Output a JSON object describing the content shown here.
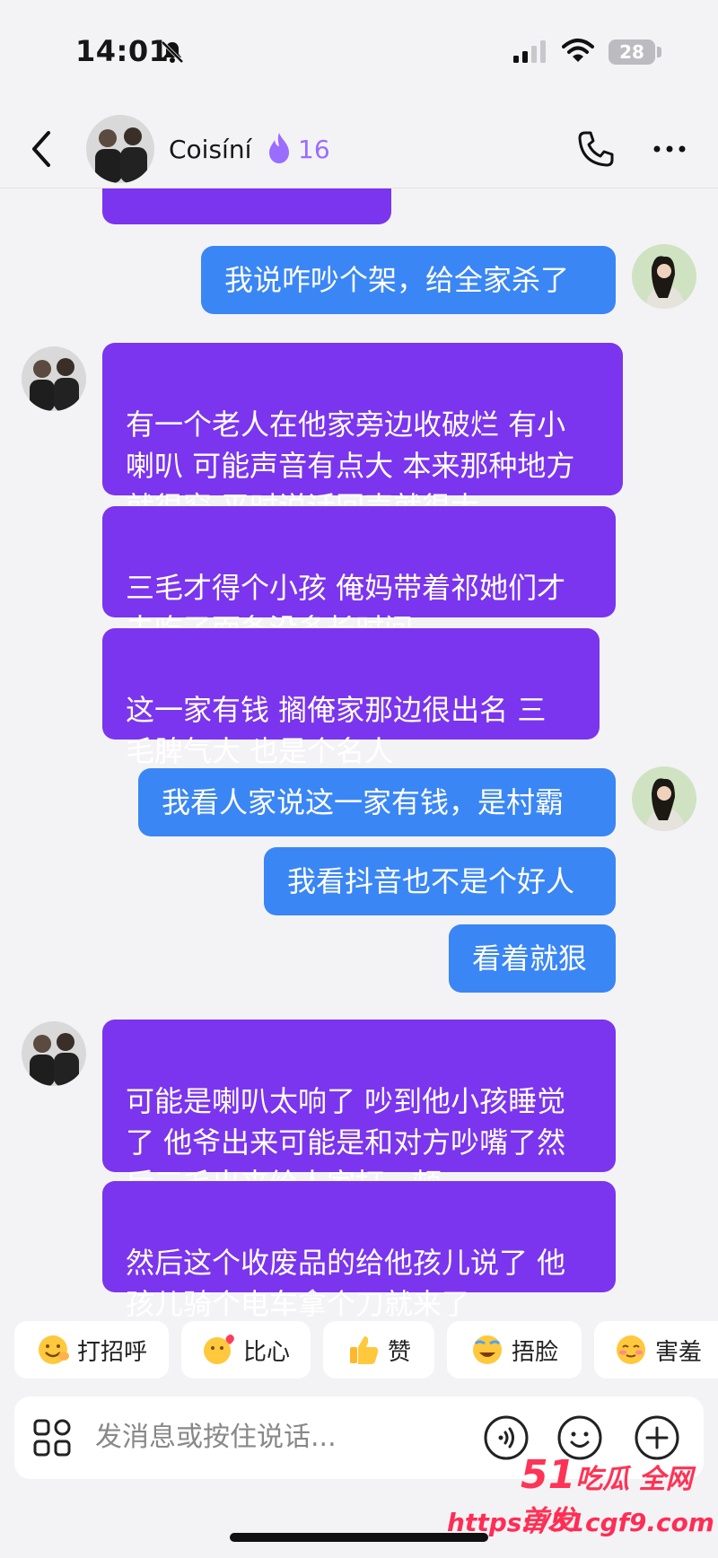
{
  "status_bar": {
    "time": "14:01",
    "battery": "28"
  },
  "header": {
    "contact_name": "Coisíní",
    "flame_count": "16"
  },
  "messages": [
    {
      "side": "left",
      "text": "有一个老人在他家旁边收破烂 有小\n喇叭 可能声音有点大 本来那种地方\n就很窄 平时说话回声就很大"
    },
    {
      "side": "left",
      "text": "三毛才得个小孩 俺妈带着祁她们才\n去吃了面条没多长时间"
    },
    {
      "side": "left",
      "text": "这一家有钱 搁俺家那边很出名  三\n毛脾气大 也是个名人"
    },
    {
      "side": "right",
      "text": "我看人家说这一家有钱，是村霸"
    },
    {
      "side": "right",
      "text": "我看抖音也不是个好人"
    },
    {
      "side": "right",
      "text": "看着就狠"
    },
    {
      "side": "left",
      "text": "可能是喇叭太响了 吵到他小孩睡觉\n了 他爷出来可能是和对方吵嘴了然\n后三毛出来给人家打一顿"
    },
    {
      "side": "left",
      "text": "然后这个收废品的给他孩儿说了 他\n孩儿骑个电车拿个刀就来了"
    }
  ],
  "top_message": {
    "text": "我说咋吵个架，给全家杀了"
  },
  "quick_replies": [
    {
      "label": "打招呼",
      "icon": "wave-emoji-icon"
    },
    {
      "label": "比心",
      "icon": "heart-hand-emoji-icon"
    },
    {
      "label": "赞",
      "icon": "thumbs-up-emoji-icon"
    },
    {
      "label": "捂脸",
      "icon": "facepalm-emoji-icon"
    },
    {
      "label": "害羞",
      "icon": "shy-emoji-icon"
    }
  ],
  "input": {
    "placeholder": "发消息或按住说话..."
  },
  "watermark": {
    "line1_num": "51",
    "line1_text": "吃瓜 全网首发",
    "line2": "https://51cgf9.com"
  },
  "colors": {
    "purple": "#7b35ee",
    "blue": "#3a86f5",
    "accent_flame": "#9a6cff"
  }
}
